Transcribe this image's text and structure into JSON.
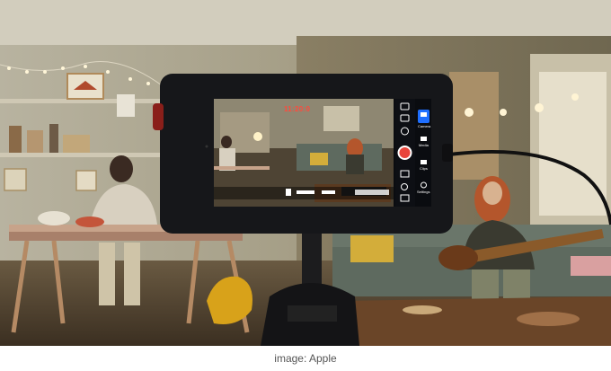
{
  "caption": "image: Apple",
  "monitor": {
    "timecode": "11:20:0",
    "sidebar": {
      "icons": [
        "monitor-icon",
        "camera-icon",
        "settings-icon",
        "grid-icon",
        "zoom-icon",
        "display-icon"
      ],
      "right_labels": [
        "Camera",
        "Media",
        "Clips",
        "Settings"
      ]
    },
    "record_button_color": "#e8453c",
    "accent_color": "#1f6fff"
  }
}
